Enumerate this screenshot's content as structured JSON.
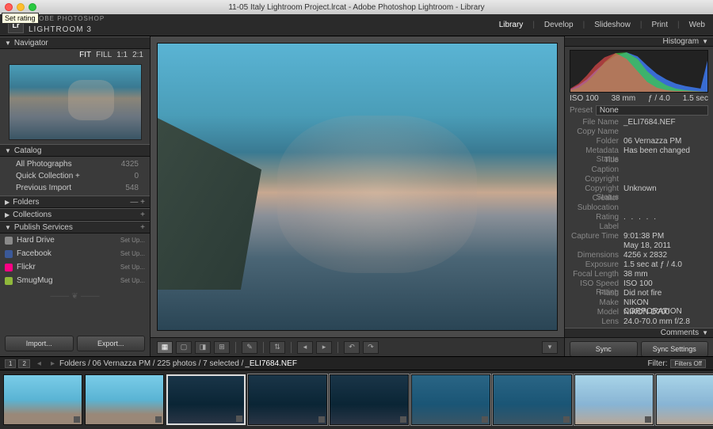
{
  "window": {
    "title": "11-05 Italy Lightroom Project.lrcat - Adobe Photoshop Lightroom - Library",
    "tooltip": "Set rating"
  },
  "app": {
    "brand_small": "ADOBE PHOTOSHOP",
    "brand": "LIGHTROOM 3",
    "logo": "Lr"
  },
  "modules": {
    "library": "Library",
    "develop": "Develop",
    "slideshow": "Slideshow",
    "print": "Print",
    "web": "Web"
  },
  "navigator": {
    "title": "Navigator",
    "fit": "FIT",
    "fill": "FILL",
    "one": "1:1",
    "two": "2:1"
  },
  "catalog": {
    "title": "Catalog",
    "items": [
      {
        "label": "All Photographs",
        "count": "4325"
      },
      {
        "label": "Quick Collection +",
        "count": "0"
      },
      {
        "label": "Previous Import",
        "count": "548"
      }
    ]
  },
  "folders": {
    "title": "Folders"
  },
  "collections": {
    "title": "Collections"
  },
  "publish": {
    "title": "Publish Services",
    "setup": "Set Up...",
    "items": [
      {
        "label": "Hard Drive",
        "color": "#8a8a8a"
      },
      {
        "label": "Facebook",
        "color": "#3b5998"
      },
      {
        "label": "Flickr",
        "color": "#ff0084"
      },
      {
        "label": "SmugMug",
        "color": "#8fb83b"
      }
    ]
  },
  "buttons": {
    "import": "Import...",
    "export": "Export...",
    "sync": "Sync",
    "sync_settings": "Sync Settings"
  },
  "histogram": {
    "title": "Histogram",
    "iso": "ISO 100",
    "focal": "38 mm",
    "aperture": "ƒ / 4.0",
    "shutter": "1.5 sec"
  },
  "preset": {
    "label": "Preset",
    "value": "None"
  },
  "metadata": {
    "file_name": {
      "k": "File Name",
      "v": "_ELI7684.NEF"
    },
    "copy_name": {
      "k": "Copy Name",
      "v": ""
    },
    "folder": {
      "k": "Folder",
      "v": "06 Vernazza PM"
    },
    "metadata_status": {
      "k": "Metadata Status",
      "v": "Has been changed"
    },
    "title": {
      "k": "Title",
      "v": ""
    },
    "caption": {
      "k": "Caption",
      "v": ""
    },
    "copyright": {
      "k": "Copyright",
      "v": ""
    },
    "copyright_status": {
      "k": "Copyright Status",
      "v": "Unknown"
    },
    "creator": {
      "k": "Creator",
      "v": ""
    },
    "sublocation": {
      "k": "Sublocation",
      "v": ""
    },
    "rating": {
      "k": "Rating",
      "v": ". . . . ."
    },
    "label": {
      "k": "Label",
      "v": ""
    },
    "capture_time": {
      "k": "Capture Time",
      "v": "9:01:38 PM"
    },
    "capture_date": {
      "k": "",
      "v": "May 18, 2011"
    },
    "dimensions": {
      "k": "Dimensions",
      "v": "4256 x 2832"
    },
    "exposure": {
      "k": "Exposure",
      "v": "1.5 sec at ƒ / 4.0"
    },
    "focal_length": {
      "k": "Focal Length",
      "v": "38 mm"
    },
    "iso_speed": {
      "k": "ISO Speed Rating",
      "v": "ISO 100"
    },
    "flash": {
      "k": "Flash",
      "v": "Did not fire"
    },
    "make": {
      "k": "Make",
      "v": "NIKON CORPORATION"
    },
    "model": {
      "k": "Model",
      "v": "NIKON D700"
    },
    "lens": {
      "k": "Lens",
      "v": "24.0-70.0 mm f/2.8"
    }
  },
  "comments": {
    "title": "Comments"
  },
  "info_strip": {
    "badge1": "1",
    "badge2": "2",
    "path": "Folders / 06 Vernazza PM / 225 photos / 7 selected /",
    "file": "_ELI7684.NEF",
    "filter_label": "Filter:",
    "filter_value": "Filters Off"
  },
  "chart_data": {
    "type": "area",
    "title": "Histogram",
    "xlabel": "",
    "ylabel": "",
    "xlim": [
      0,
      255
    ],
    "ylim": [
      0,
      100
    ],
    "series": [
      {
        "name": "R",
        "color": "#ff4040",
        "values": [
          5,
          10,
          28,
          55,
          78,
          90,
          60,
          30,
          12,
          5,
          3,
          2,
          1,
          0,
          0,
          0
        ]
      },
      {
        "name": "G",
        "color": "#40ff40",
        "values": [
          2,
          6,
          18,
          40,
          70,
          95,
          85,
          55,
          30,
          15,
          8,
          4,
          2,
          1,
          0,
          0
        ]
      },
      {
        "name": "B",
        "color": "#4080ff",
        "values": [
          0,
          1,
          4,
          12,
          30,
          55,
          82,
          96,
          88,
          70,
          50,
          34,
          22,
          14,
          10,
          60
        ]
      }
    ]
  }
}
